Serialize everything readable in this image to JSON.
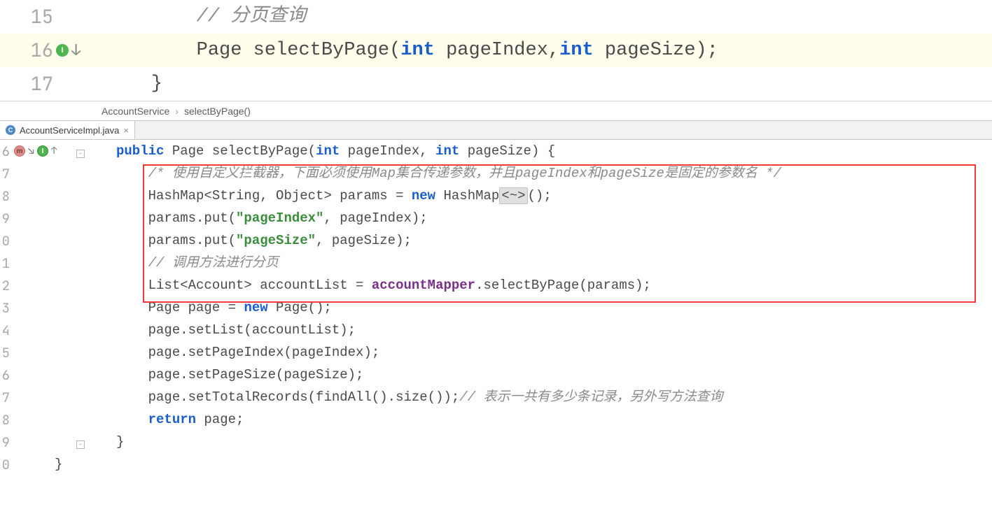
{
  "top_editor": {
    "lines": [
      {
        "num": "15",
        "segs": [
          {
            "t": "        // 分页查询",
            "cls": "comment-it"
          }
        ]
      },
      {
        "num": "16",
        "highlight": true,
        "badge": "I",
        "arrow": true,
        "segs": [
          {
            "t": "        Page selectByPage("
          },
          {
            "t": "int",
            "cls": "kw-blue"
          },
          {
            "t": " pageIndex,"
          },
          {
            "t": "int",
            "cls": "kw-blue"
          },
          {
            "t": " pageSize);"
          }
        ]
      },
      {
        "num": "17",
        "segs": [
          {
            "t": "    }"
          }
        ]
      }
    ]
  },
  "breadcrumb": {
    "root": "AccountService",
    "leaf": "selectByPage()"
  },
  "tab": {
    "label": "AccountServiceImpl.java"
  },
  "bottom_editor": {
    "lines": [
      {
        "num": "6",
        "badges": true,
        "segs": [
          {
            "t": "public",
            "cls": "kw-blue"
          },
          {
            "t": " Page selectByPage("
          },
          {
            "t": "int",
            "cls": "kw-blue"
          },
          {
            "t": " pageIndex, "
          },
          {
            "t": "int",
            "cls": "kw-blue"
          },
          {
            "t": " pageSize) {"
          }
        ]
      },
      {
        "num": "7",
        "segs": [
          {
            "t": "    /* 使用自定义拦截器，下面必须使用Map集合传递参数，并且pageIndex和pageSize是固定的参数名 */",
            "cls": "comment-it"
          }
        ]
      },
      {
        "num": "8",
        "segs": [
          {
            "t": "    HashMap<String, Object> params = "
          },
          {
            "t": "new",
            "cls": "kw-blue"
          },
          {
            "t": " HashMap"
          },
          {
            "t": "<~>",
            "cls": "generic-fold"
          },
          {
            "t": "();"
          }
        ]
      },
      {
        "num": "9",
        "segs": [
          {
            "t": "    params.put("
          },
          {
            "t": "\"pageIndex\"",
            "cls": "str-green"
          },
          {
            "t": ", pageIndex);"
          }
        ]
      },
      {
        "num": "0",
        "segs": [
          {
            "t": "    params.put("
          },
          {
            "t": "\"pageSize\"",
            "cls": "str-green"
          },
          {
            "t": ", pageSize);"
          }
        ]
      },
      {
        "num": "1",
        "segs": [
          {
            "t": "    // 调用方法进行分页",
            "cls": "comment-it"
          }
        ]
      },
      {
        "num": "2",
        "segs": [
          {
            "t": "    List<Account> accountList = "
          },
          {
            "t": "accountMapper",
            "cls": "field-purple kw-bold"
          },
          {
            "t": ".selectByPage(params);"
          }
        ]
      },
      {
        "num": "3",
        "segs": [
          {
            "t": "    Page page = "
          },
          {
            "t": "new",
            "cls": "kw-blue"
          },
          {
            "t": " Page();"
          }
        ]
      },
      {
        "num": "4",
        "segs": [
          {
            "t": "    page.setList(accountList);"
          }
        ]
      },
      {
        "num": "5",
        "segs": [
          {
            "t": "    page.setPageIndex(pageIndex);"
          }
        ]
      },
      {
        "num": "6",
        "segs": [
          {
            "t": "    page.setPageSize(pageSize);"
          }
        ]
      },
      {
        "num": "7",
        "segs": [
          {
            "t": "    page.setTotalRecords(findAll().size());"
          },
          {
            "t": "// 表示一共有多少条记录，另外写方法查询",
            "cls": "comment-it"
          }
        ]
      },
      {
        "num": "8",
        "segs": [
          {
            "t": "    "
          },
          {
            "t": "return",
            "cls": "kw-blue"
          },
          {
            "t": " page;"
          }
        ]
      },
      {
        "num": "9",
        "fold_end": true,
        "segs": [
          {
            "t": "}"
          }
        ]
      },
      {
        "num": "0",
        "segs": [
          {
            "t": "",
            "extra_unindent": true
          }
        ],
        "unindent": true
      }
    ]
  }
}
